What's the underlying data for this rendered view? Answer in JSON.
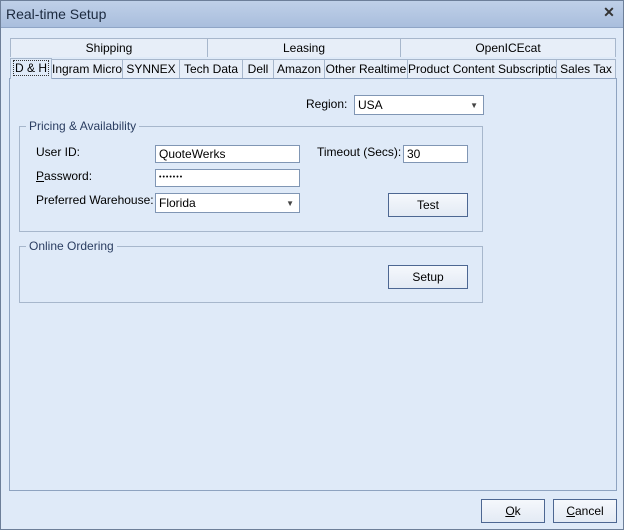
{
  "window": {
    "title": "Real-time Setup"
  },
  "tabs_top": [
    {
      "label": "Shipping"
    },
    {
      "label": "Leasing"
    },
    {
      "label": "OpenICEcat"
    }
  ],
  "tabs_bottom": [
    {
      "label": "D & H"
    },
    {
      "label": "Ingram Micro"
    },
    {
      "label": "SYNNEX"
    },
    {
      "label": "Tech Data"
    },
    {
      "label": "Dell"
    },
    {
      "label": "Amazon"
    },
    {
      "label": "Other Realtime"
    },
    {
      "label": "Product Content Subscription"
    },
    {
      "label": "Sales Tax"
    }
  ],
  "region": {
    "label": "Region:",
    "value": "USA"
  },
  "pricing": {
    "group_label": "Pricing & Availability",
    "user_id_label": "User ID:",
    "user_id_value": "QuoteWerks",
    "password_label_first": "P",
    "password_label_rest": "assword:",
    "password_value": "•••••••",
    "warehouse_label": "Preferred Warehouse:",
    "warehouse_value": "Florida",
    "timeout_label": "Timeout (Secs):",
    "timeout_value": "30",
    "test_label": "Test"
  },
  "ordering": {
    "group_label": "Online Ordering",
    "setup_label": "Setup"
  },
  "footer": {
    "ok_first": "O",
    "ok_rest": "k",
    "cancel_first": "C",
    "cancel_rest": "ancel"
  }
}
